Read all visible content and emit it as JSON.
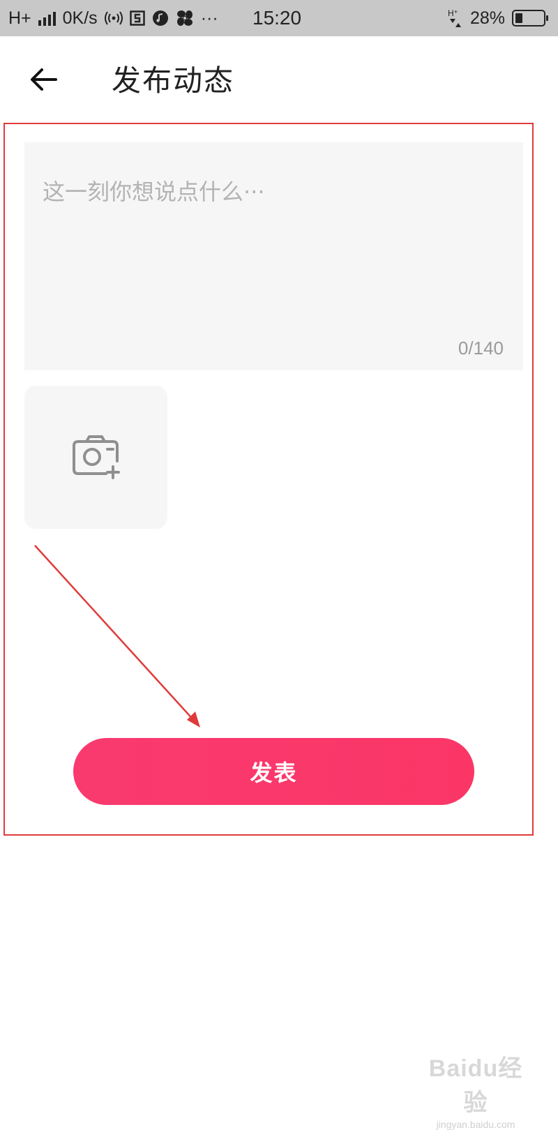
{
  "status_bar": {
    "network_type": "H+",
    "speed": "0K/s",
    "time": "15:20",
    "battery_percent": "28%",
    "icons": [
      "signal-icon",
      "hotspot-icon",
      "app-icon-s",
      "music-icon",
      "fan-icon",
      "more-icon",
      "hplus-data-icon",
      "battery-icon"
    ],
    "more_glyph": "···"
  },
  "header": {
    "back_icon": "arrow-left-icon",
    "title": "发布动态"
  },
  "composer": {
    "placeholder": "这一刻你想说点什么···",
    "counter": "0/140",
    "add_photo_icon": "camera-plus-icon"
  },
  "publish_button": {
    "label": "发表",
    "color": "#f93a6f"
  },
  "annotation": {
    "frame_color": "#e03a3a",
    "arrow_color": "#e03a3a"
  },
  "watermark": {
    "brand": "Baidu经验",
    "url": "jingyan.baidu.com"
  }
}
